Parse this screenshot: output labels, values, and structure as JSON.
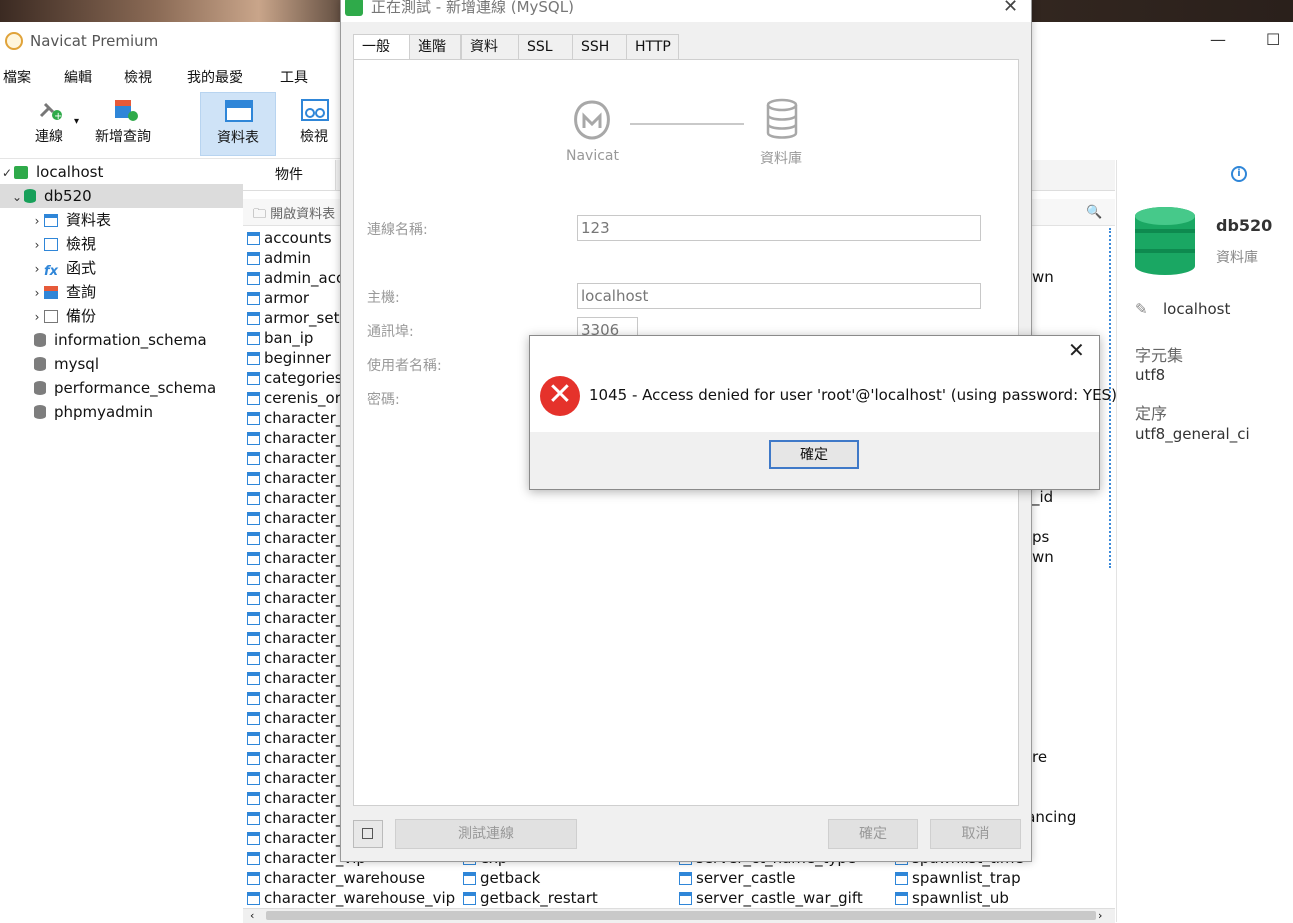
{
  "app": {
    "title": "Navicat Premium"
  },
  "menu": [
    "檔案",
    "編輯",
    "檢視",
    "我的最愛",
    "工具"
  ],
  "toolbar": {
    "connect": "連線",
    "new_query": "新增查詢",
    "tables": "資料表",
    "views": "檢視"
  },
  "tree": {
    "connection": "localhost",
    "database": "db520",
    "children": [
      "資料表",
      "檢視",
      "函式",
      "查詢",
      "備份"
    ],
    "other_dbs": [
      "information_schema",
      "mysql",
      "performance_schema",
      "phpmyadmin"
    ]
  },
  "objects": {
    "tab": "物件",
    "open_table": "開啟資料表",
    "col1": [
      "accounts",
      "admin",
      "admin_acce",
      "armor",
      "armor_set",
      "ban_ip",
      "beginner",
      "categories",
      "cerenis_orig",
      "character_b",
      "character_b",
      "character_b",
      "character_b",
      "character_c",
      "character_c",
      "character_c",
      "character_e",
      "character_g",
      "character_it",
      "character_it",
      "character_it",
      "character_it",
      "character_le",
      "character_n",
      "character_q",
      "character_p",
      "character_q",
      "character_s",
      "character_s",
      "character_s",
      "character_te",
      "character_vip",
      "character_warehouse",
      "character_warehouse_vip"
    ],
    "col2_bottom": [
      "exp",
      "getback",
      "getback_restart"
    ],
    "col3_bottom": [
      "server_ct_name_type",
      "server_castle",
      "server_castle_war_gift"
    ],
    "col4_bottom": [
      "spawnlist_time",
      "spawnlist_trap",
      "spawnlist_ub"
    ],
    "col4_fragments": [
      "wn",
      "_id",
      "ps",
      "wn",
      "re",
      "nstancing",
      "y"
    ]
  },
  "info": {
    "name": "db520",
    "type": "資料庫",
    "host": "localhost",
    "charset_label": "字元集",
    "charset": "utf8",
    "collation_label": "定序",
    "collation": "utf8_general_ci"
  },
  "dialog": {
    "title": "正在測試 - 新增連線 (MySQL)",
    "tabs": [
      "一般",
      "進階",
      "資料庫",
      "SSL",
      "SSH",
      "HTTP"
    ],
    "diagram_left": "Navicat",
    "diagram_right": "資料庫",
    "fields": {
      "conn_name_label": "連線名稱:",
      "conn_name": "123",
      "host_label": "主機:",
      "host": "localhost",
      "port_label": "通訊埠:",
      "port": "3306",
      "user_label": "使用者名稱:",
      "password_label": "密碼:"
    },
    "test_btn": "測試連線",
    "ok_btn": "確定",
    "cancel_btn": "取消"
  },
  "error": {
    "message": "1045 - Access denied for user 'root'@'localhost' (using password: YES)",
    "ok": "確定"
  }
}
